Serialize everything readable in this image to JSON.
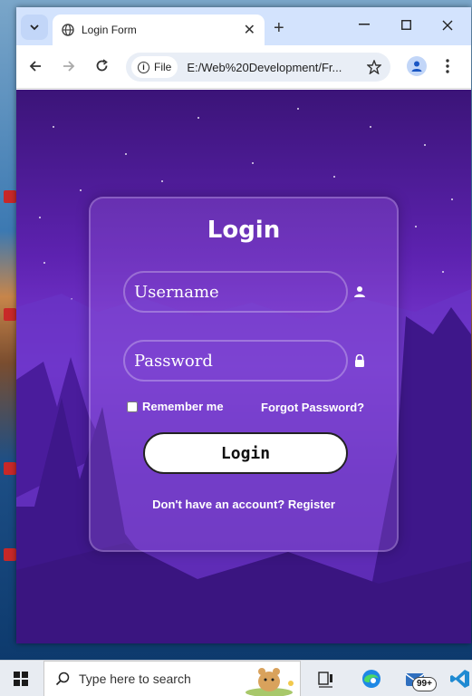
{
  "browser": {
    "tab_title": "Login Form",
    "close_label": "✕",
    "new_tab_label": "+",
    "chip_label": "File",
    "url": "E:/Web%20Development/Fr..."
  },
  "login": {
    "title": "Login",
    "username_placeholder": "Username",
    "password_placeholder": "Password",
    "remember_label": "Remember me",
    "forgot_label": "Forgot Password?",
    "button_label": "Login",
    "register_prompt": "Don't have an account?",
    "register_link": "Register"
  },
  "taskbar": {
    "search_placeholder": "Type here to search",
    "badge": "99+"
  },
  "colors": {
    "page_purple": "#5d22b0",
    "card_border": "#ffffff"
  }
}
